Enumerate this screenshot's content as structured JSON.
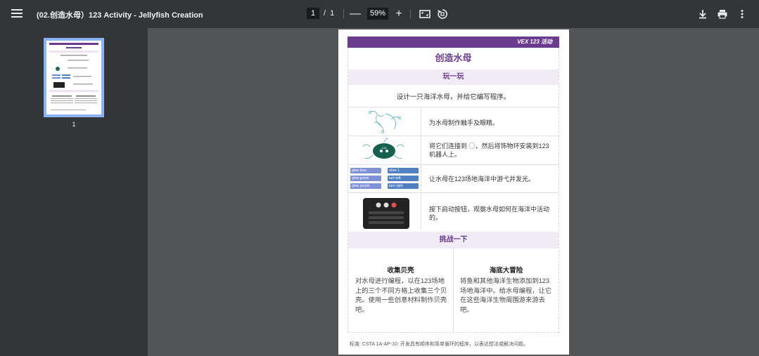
{
  "toolbar": {
    "title": "(02.创造水母）123 Activity - Jellyfish Creation",
    "page_current": "1",
    "page_sep": "/",
    "page_total": "1",
    "zoom_out": "—",
    "zoom": "59%",
    "zoom_in": "+",
    "icons": [
      "menu-icon",
      "fit-page-icon",
      "rotate-icon",
      "download-icon",
      "print-icon",
      "more-vert-icon"
    ]
  },
  "sidebar": {
    "thumbnail_label": "1"
  },
  "document": {
    "banner_logo": "VEX 123 活动",
    "title": "创造水母",
    "play_heading": "玩一玩",
    "play_intro": "设计一只海洋水母，并给它编写程序。",
    "steps": [
      {
        "text": "为水母制作触手及眼睛。"
      },
      {
        "text": "将它们连接到 ◯，然后将饰物环安装到123机器人上。"
      },
      {
        "text": "让水母在123场地海洋中游弋并发光。"
      },
      {
        "text": "按下启动按钮，观察水母如何在海洋中活动的。"
      }
    ],
    "code_blocks_left": [
      "glow blue",
      "glow green",
      "glow purple"
    ],
    "code_blocks_right": [
      "drive 1",
      "turn left",
      "turn right"
    ],
    "challenge_heading": "挑战一下",
    "challenges": [
      {
        "title": "收集贝壳",
        "text": "对水母进行编程，以在123场地上的三个不同方格上收集三个贝壳。使用一些创意材料制作贝壳吧。"
      },
      {
        "title": "海底大冒险",
        "text": "将鱼和其他海洋生物添加到123场地海洋中。给水母编程，让它在这些海洋生物周围游来游去吧。"
      }
    ],
    "footer": "标准: CSTA 1A-AP-10: 开发具有顺序和简单循环的程序，以表达想法或解决问题。"
  },
  "colors": {
    "brand_purple": "#6a3b8f",
    "band_bg": "#f1ebf5",
    "toolbar_bg": "#323639",
    "viewer_bg": "#525659"
  }
}
